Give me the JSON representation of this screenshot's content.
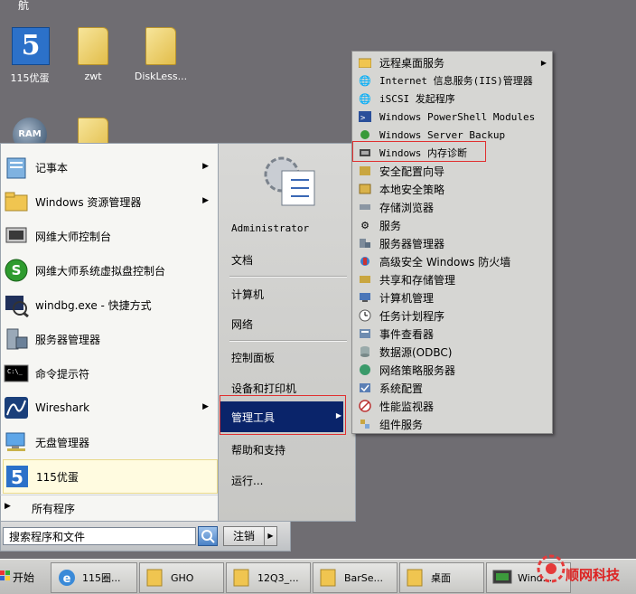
{
  "desktop": {
    "top_label": "航",
    "icons": [
      {
        "label": "115优蛋",
        "icon": "app-115-icon"
      },
      {
        "label": "zwt",
        "icon": "folder-icon"
      },
      {
        "label": "DiskLess...",
        "icon": "folder-icon"
      },
      {
        "label": "RAM",
        "icon": "ram-icon"
      }
    ]
  },
  "start_menu": {
    "programs": [
      {
        "label": "记事本",
        "has_arrow": true,
        "icon": "notepad-icon"
      },
      {
        "label": "Windows 资源管理器",
        "has_arrow": true,
        "icon": "explorer-icon"
      },
      {
        "label": "网维大师控制台",
        "has_arrow": false,
        "icon": "console-icon"
      },
      {
        "label": "网维大师系统虚拟盘控制台",
        "has_arrow": false,
        "icon": "green-s-icon"
      },
      {
        "label": "windbg.exe - 快捷方式",
        "has_arrow": false,
        "icon": "windbg-icon"
      },
      {
        "label": "服务器管理器",
        "has_arrow": false,
        "icon": "server-manager-icon"
      },
      {
        "label": "命令提示符",
        "has_arrow": false,
        "icon": "cmd-icon"
      },
      {
        "label": "Wireshark",
        "has_arrow": true,
        "icon": "wireshark-icon"
      },
      {
        "label": "无盘管理器",
        "has_arrow": false,
        "icon": "diskless-icon"
      },
      {
        "label": "115优蛋",
        "has_arrow": false,
        "icon": "app-115-icon"
      }
    ],
    "all_programs": "所有程序",
    "search_placeholder": "搜索程序和文件",
    "right": {
      "user": "Administrator",
      "documents": "文档",
      "computer": "计算机",
      "network": "网络",
      "control_panel": "控制面板",
      "devices_printers": "设备和打印机",
      "admin_tools": "管理工具",
      "help": "帮助和支持",
      "run": "运行..."
    },
    "logoff": "注销",
    "logoff_arrow": "▶"
  },
  "admin_submenu": [
    {
      "label": "远程桌面服务",
      "has_arrow": true
    },
    {
      "label": "Internet 信息服务(IIS)管理器",
      "has_arrow": false
    },
    {
      "label": "iSCSI 发起程序",
      "has_arrow": false
    },
    {
      "label": "Windows PowerShell Modules",
      "has_arrow": false
    },
    {
      "label": "Windows Server Backup",
      "has_arrow": false
    },
    {
      "label": "Windows 内存诊断",
      "has_arrow": false
    },
    {
      "label": "安全配置向导",
      "has_arrow": false
    },
    {
      "label": "本地安全策略",
      "has_arrow": false
    },
    {
      "label": "存储浏览器",
      "has_arrow": false
    },
    {
      "label": "服务",
      "has_arrow": false
    },
    {
      "label": "服务器管理器",
      "has_arrow": false
    },
    {
      "label": "高级安全 Windows 防火墙",
      "has_arrow": false
    },
    {
      "label": "共享和存储管理",
      "has_arrow": false
    },
    {
      "label": "计算机管理",
      "has_arrow": false
    },
    {
      "label": "任务计划程序",
      "has_arrow": false
    },
    {
      "label": "事件查看器",
      "has_arrow": false
    },
    {
      "label": "数据源(ODBC)",
      "has_arrow": false
    },
    {
      "label": "网络策略服务器",
      "has_arrow": false
    },
    {
      "label": "系统配置",
      "has_arrow": false
    },
    {
      "label": "性能监视器",
      "has_arrow": false
    },
    {
      "label": "组件服务",
      "has_arrow": false
    }
  ],
  "taskbar": {
    "start_label": "开始",
    "buttons": [
      {
        "label": "115圈...",
        "icon": "ie-icon"
      },
      {
        "label": "GHO",
        "icon": "folder-icon"
      },
      {
        "label": "12Q3_...",
        "icon": "folder-icon"
      },
      {
        "label": "BarSe...",
        "icon": "folder-icon"
      },
      {
        "label": "桌面",
        "icon": "folder-icon"
      },
      {
        "label": "Wind...",
        "icon": "monitor-icon"
      }
    ],
    "watermark": "顺网科技"
  },
  "colors": {
    "highlight_box": "#e03030",
    "selected_bg": "#0a246a"
  }
}
